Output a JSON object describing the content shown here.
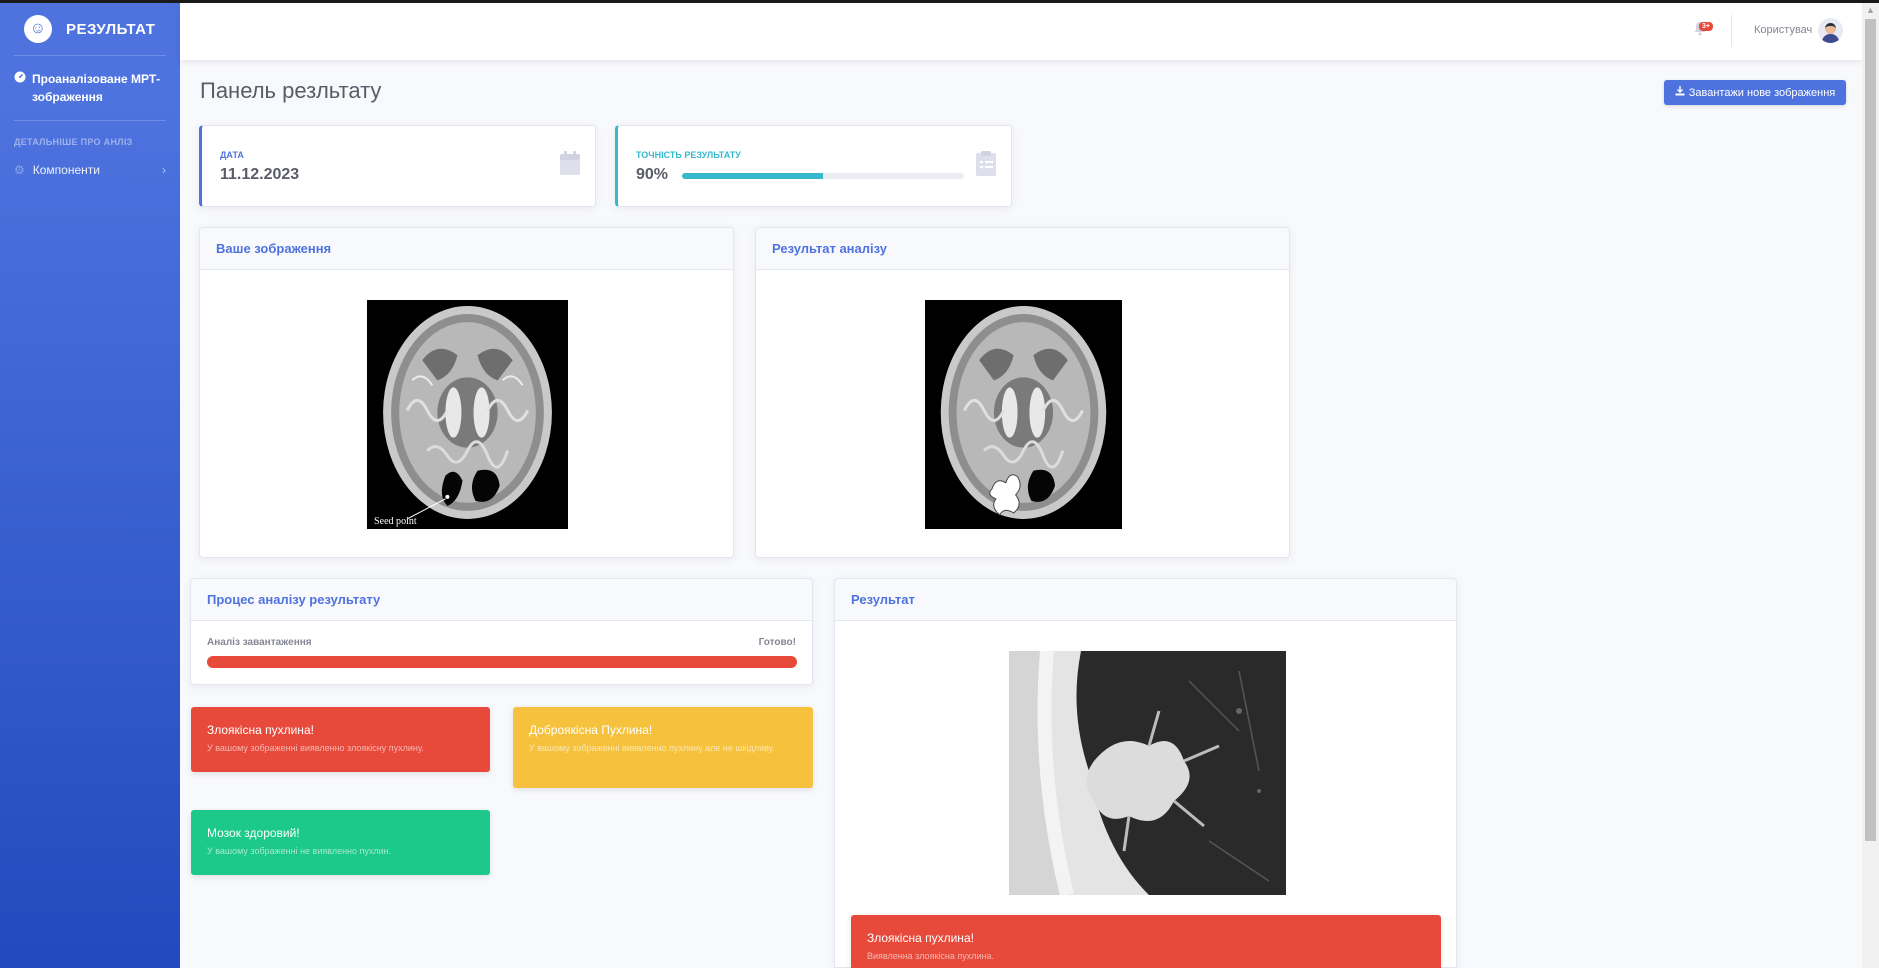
{
  "sidebar": {
    "brand": "РЕЗУЛЬТАТ",
    "active_item": "Проаналізоване МРТ-зображення",
    "section_heading": "ДЕТАЛЬНІШЕ ПРО АНЛІЗ",
    "items": [
      {
        "label": "Компоненти",
        "icon": "gear-icon"
      }
    ]
  },
  "topbar": {
    "notification_badge": "3+",
    "username": "Користувач"
  },
  "page": {
    "title": "Панель резльтату",
    "upload_button": "Завантажи нове зображення"
  },
  "stats": {
    "date": {
      "label": "ДАТА",
      "value": "11.12.2023"
    },
    "accuracy": {
      "label": "ТОЧНІСТЬ РЕЗУЛЬТАТУ",
      "value": "90%",
      "progress_fraction": 0.5
    }
  },
  "panels": {
    "your_image": {
      "title": "Ваше зображення",
      "annotation": "Seed point"
    },
    "analysis_result": {
      "title": "Результат аналізу"
    },
    "process": {
      "title": "Процес аналізу результату",
      "label": "Аналіз завантаження",
      "status": "Готово!",
      "progress_fraction": 1.0
    },
    "result": {
      "title": "Результат"
    }
  },
  "alerts": {
    "malignant": {
      "title": "Злоякісна пухлина!",
      "text": "У вашому зображенні виявленно злоякісну пухлину."
    },
    "benign": {
      "title": "Доброякісна Пухлина!",
      "text": "У вашому зображенні виявленно пухлину але не шкідливу."
    },
    "healthy": {
      "title": "Мозок здоровий!",
      "text": "У вашому зображенні не виявленно пухлин."
    },
    "result": {
      "title": "Злоякісна пухлина!",
      "text": "Виявленна злоякісна пухлина."
    }
  },
  "colors": {
    "primary": "#4e73df",
    "info": "#36b9cc",
    "danger": "#e74a3b",
    "warning": "#f6c23e",
    "success": "#1cc88a"
  }
}
